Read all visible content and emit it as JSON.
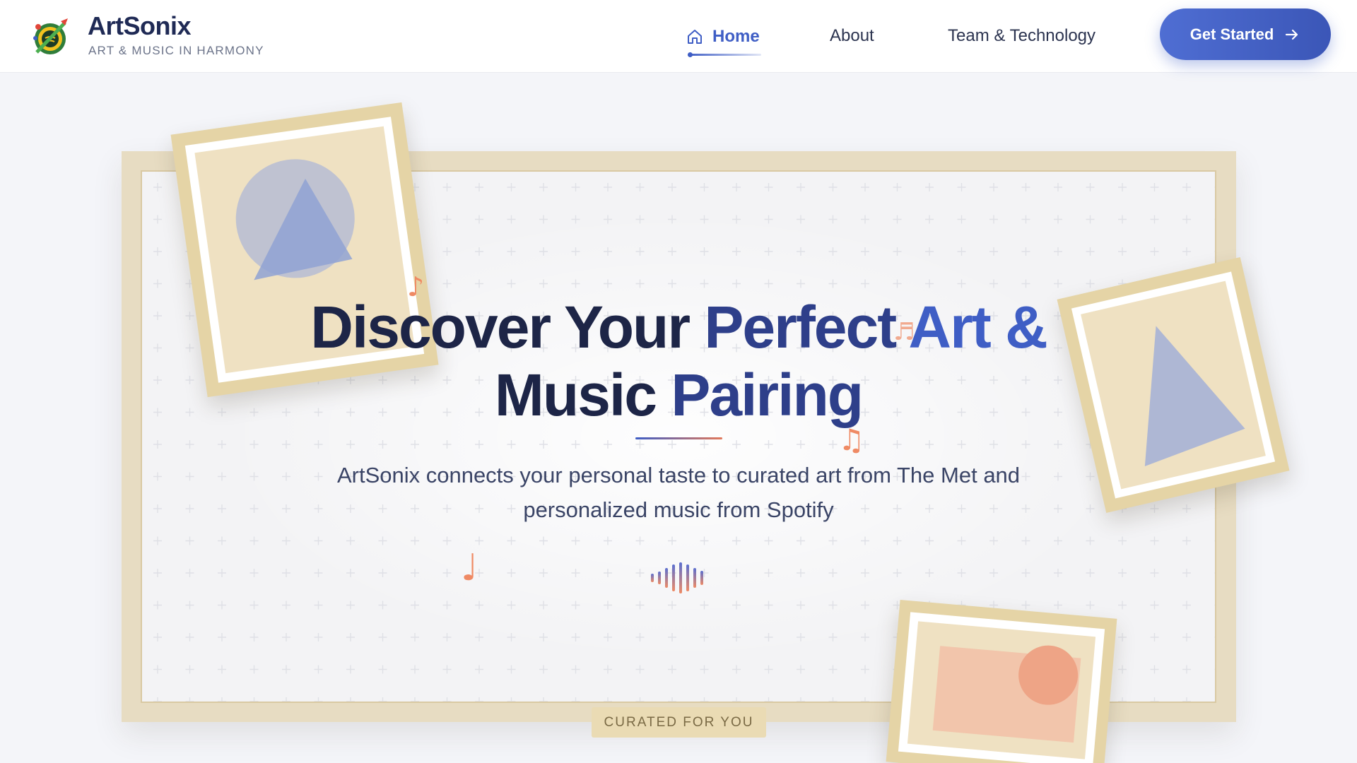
{
  "brand": {
    "name": "ArtSonix",
    "tagline": "ART & MUSIC IN HARMONY",
    "logo_icon": "palette-music-logo-icon"
  },
  "nav": {
    "items": [
      {
        "label": "Home",
        "icon": "home-icon",
        "active": true
      },
      {
        "label": "About",
        "active": false
      },
      {
        "label": "Team & Technology",
        "active": false
      }
    ],
    "cta_label": "Get Started",
    "cta_icon": "arrow-right-icon"
  },
  "hero": {
    "title_part1": "Discover Your ",
    "title_part2": "Perfect",
    "title_part3": " Art &",
    "title_part4": "Music ",
    "title_part5": "Pairing",
    "subtitle_line1": "ArtSonix connects your personal taste to curated art from The Met and",
    "subtitle_line2": "personalized music from Spotify",
    "badge": "CURATED FOR YOU"
  },
  "decor": {
    "notes": [
      "♪",
      "♬",
      "♫",
      "♩"
    ],
    "equalizer_icon": "sound-wave-icon"
  },
  "colors": {
    "accent_blue": "#3f5ec5",
    "navy": "#1d2547",
    "coral": "#ef8a64",
    "frame_gold": "#e5d4a6"
  }
}
